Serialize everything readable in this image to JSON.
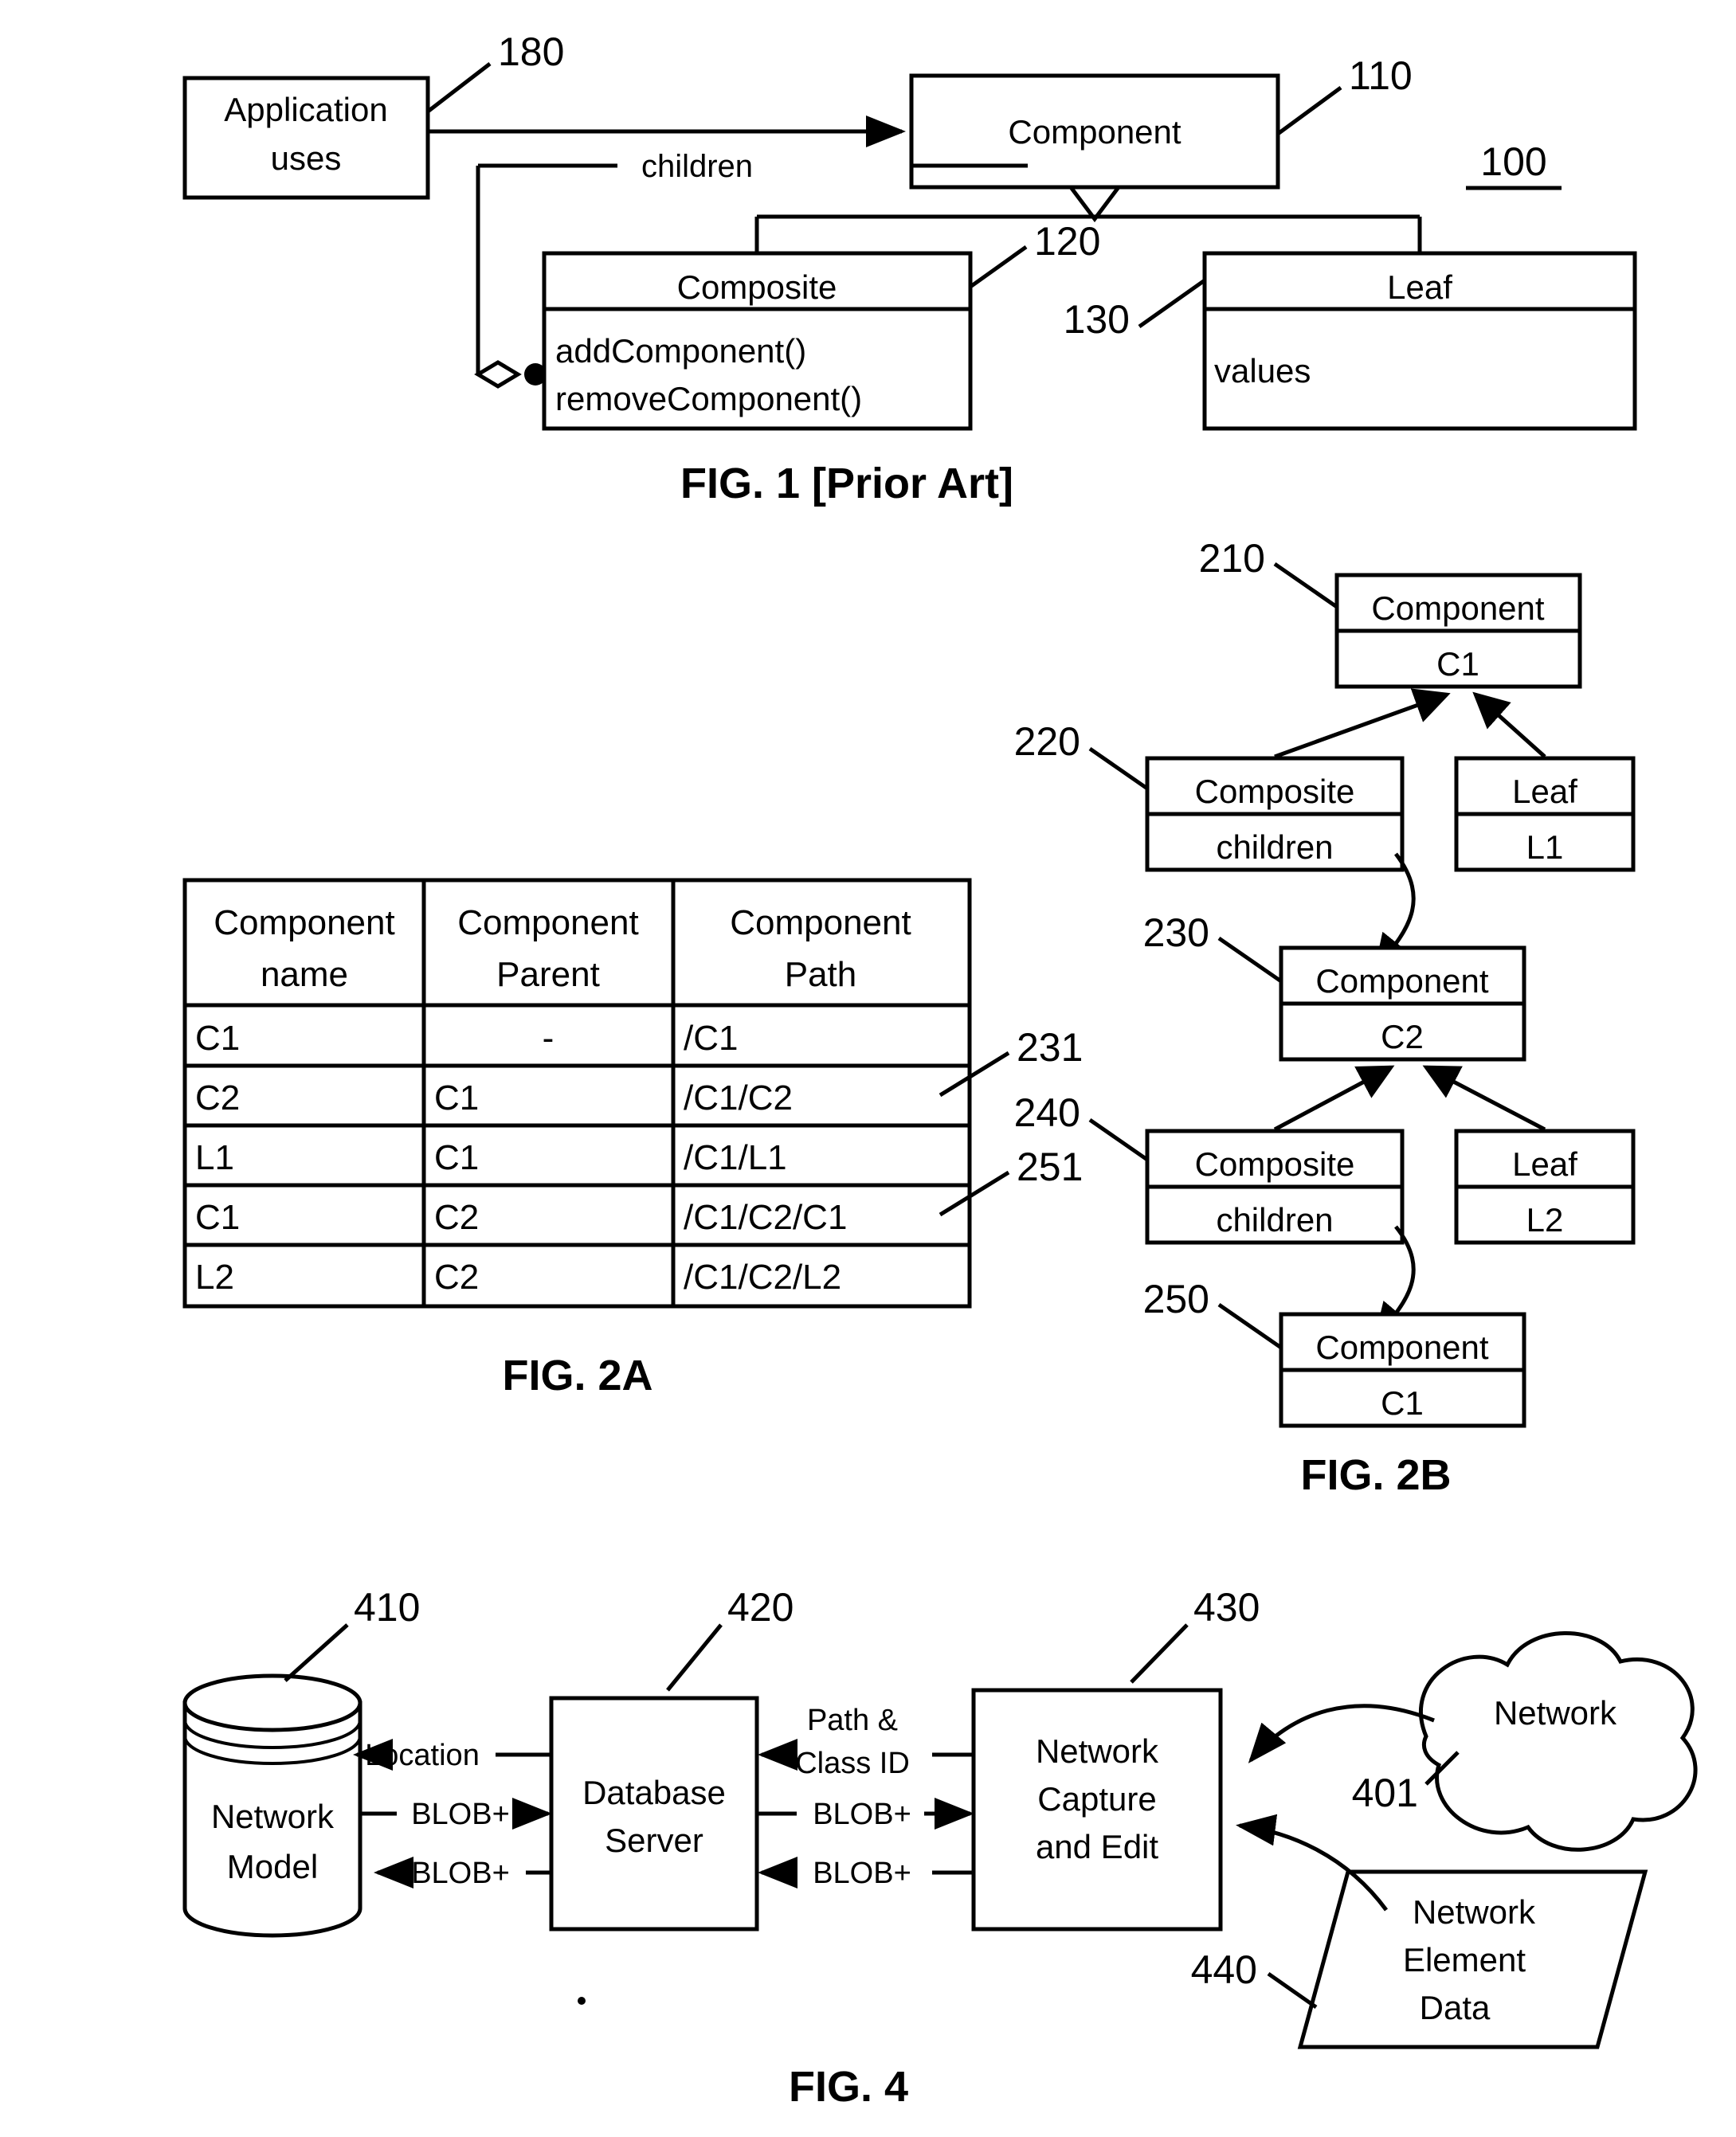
{
  "document": {
    "type": "patent-drawing-sheet",
    "figures": [
      "FIG. 1 [Prior Art]",
      "FIG. 2A",
      "FIG. 2B",
      "FIG. 4"
    ]
  },
  "fig1": {
    "caption": "FIG. 1 [Prior Art]",
    "sheet_ref": "100",
    "boxes": {
      "application": {
        "line1": "Application",
        "line2": "uses",
        "ref": "180"
      },
      "component": {
        "title": "Component",
        "ref": "110"
      },
      "composite": {
        "title": "Composite",
        "method1": "addComponent()",
        "method2": "removeComponent()",
        "ref": "120"
      },
      "leaf": {
        "title": "Leaf",
        "attr": "values",
        "ref": "130"
      }
    },
    "edges": {
      "children_label": "children"
    }
  },
  "fig2a": {
    "caption": "FIG. 2A",
    "table": {
      "headers": [
        {
          "line1": "Component",
          "line2": "name"
        },
        {
          "line1": "Component",
          "line2": "Parent"
        },
        {
          "line1": "Component",
          "line2": "Path"
        }
      ],
      "rows": [
        {
          "name": "C1",
          "parent": "-",
          "path": "/C1"
        },
        {
          "name": "C2",
          "parent": "C1",
          "path": "/C1/C2"
        },
        {
          "name": "L1",
          "parent": "C1",
          "path": "/C1/L1"
        },
        {
          "name": "C1",
          "parent": "C2",
          "path": "/C1/C2/C1"
        },
        {
          "name": "L2",
          "parent": "C2",
          "path": "/C1/C2/L2"
        }
      ]
    },
    "refs": {
      "row2": "231",
      "row4": "251"
    }
  },
  "fig2b": {
    "caption": "FIG. 2B",
    "nodes": {
      "component_c1_top": {
        "title": "Component",
        "value": "C1",
        "ref": "210"
      },
      "composite_1": {
        "title": "Composite",
        "value": "children",
        "ref": "220"
      },
      "leaf_l1": {
        "title": "Leaf",
        "value": "L1"
      },
      "component_c2": {
        "title": "Component",
        "value": "C2",
        "ref": "230"
      },
      "composite_2": {
        "title": "Composite",
        "value": "children",
        "ref": "240"
      },
      "leaf_l2": {
        "title": "Leaf",
        "value": "L2"
      },
      "component_c1_bot": {
        "title": "Component",
        "value": "C1",
        "ref": "250"
      }
    }
  },
  "fig4": {
    "caption": "FIG. 4",
    "nodes": {
      "network_model": {
        "line1": "Network",
        "line2": "Model",
        "ref": "410"
      },
      "database_server": {
        "line1": "Database",
        "line2": "Server",
        "ref": "420"
      },
      "network_capture": {
        "line1": "Network",
        "line2": "Capture",
        "line3": "and Edit",
        "ref": "430"
      },
      "network_cloud": {
        "label": "Network",
        "ref": "401"
      },
      "network_element_data": {
        "line1": "Network",
        "line2": "Element",
        "line3": "Data",
        "ref": "440"
      }
    },
    "edges": {
      "location": "Location",
      "blob_to_db": "BLOB+",
      "blob_from_db": "BLOB+",
      "path_class_id_1": "Path &",
      "path_class_id_2": "Class ID",
      "blob_in": "BLOB+",
      "blob_out": "BLOB+"
    }
  },
  "colors": {
    "ink": "#000000",
    "paper": "#ffffff"
  }
}
